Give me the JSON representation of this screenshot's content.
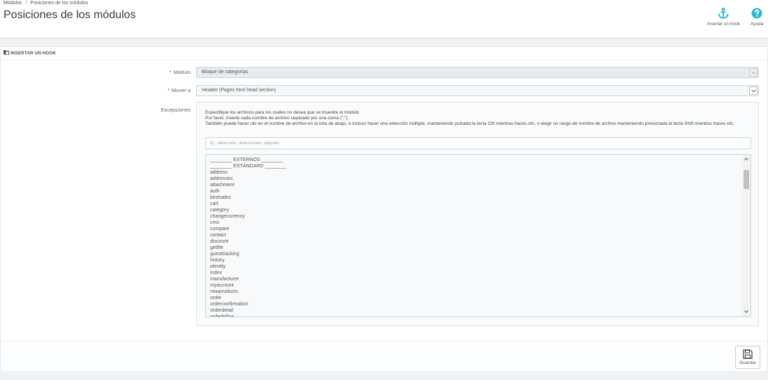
{
  "breadcrumb": {
    "parent": "Módulos",
    "separator": "/",
    "current": "Posiciones de los módulos"
  },
  "page": {
    "title": "Posiciones de los módulos"
  },
  "toolbar": {
    "insert_hook_label": "Insertar un hook",
    "help_label": "Ayuda",
    "insert_hook_icon": "anchor-icon",
    "help_icon": "question-circle-icon",
    "accent_color": "#25b9d7"
  },
  "panel": {
    "heading": "INSERTAR UN HOOK",
    "heading_icon": "copy-icon",
    "module_label": "Módulo",
    "module_value": "Bloque de categorías",
    "move_label": "Mover a",
    "move_value": "Header (Pages html head section)",
    "exceptions_label": "Excepciones",
    "required_mark": "*",
    "help_line1": "Especifique los archivos para los cuales no desea que se muestre el módulo",
    "help_line2": "Por favor, inserte cada nombre de archivo separado por una coma (\",\").",
    "help_line3": "También puede hacer clic en el nombre de archivo en la lista de abajo, e incluso hacer una selección múltiple, manteniendo pulsada la tecla Ctrl mientras haces clic, o elegir un rango de nombre de archivo manteniendo presionada la tecla Shift mientras haces clic.",
    "exceptions_placeholder": "Ej.: dirección, direcciones, adjunto",
    "file_options": [
      "________ EXTERNOS ________",
      "________ ESTÁNDARD ________",
      "address",
      "addresses",
      "attachment",
      "auth",
      "bestsales",
      "cart",
      "category",
      "changecurrency",
      "cms",
      "compare",
      "contact",
      "discount",
      "getfile",
      "guesttracking",
      "history",
      "identity",
      "index",
      "manufacturer",
      "myaccount",
      "newproducts",
      "order",
      "orderconfirmation",
      "orderdetail",
      "orderfollow"
    ],
    "save_label": "Guardar",
    "save_icon": "floppy-disk-icon",
    "required_color": "#e0282e"
  }
}
